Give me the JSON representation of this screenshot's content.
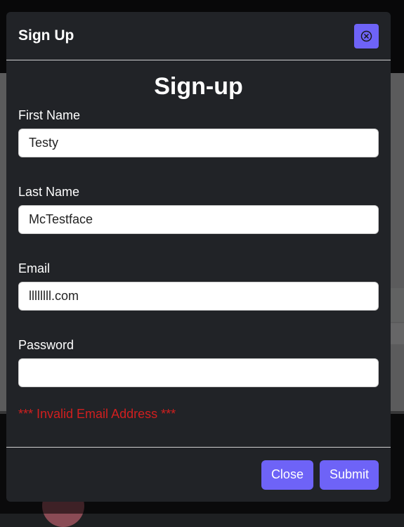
{
  "modal": {
    "title": "Sign Up",
    "close_icon": "close-circle-icon"
  },
  "form": {
    "heading": "Sign-up",
    "fields": [
      {
        "label": "First Name",
        "value": "Testy",
        "type": "text"
      },
      {
        "label": "Last Name",
        "value": "McTestface",
        "type": "text"
      },
      {
        "label": "Email",
        "value": "llllllll.com",
        "type": "text"
      },
      {
        "label": "Password",
        "value": "",
        "type": "password"
      }
    ],
    "error": "*** Invalid Email Address ***"
  },
  "footer": {
    "close_label": "Close",
    "submit_label": "Submit"
  },
  "colors": {
    "accent": "#6e63f7",
    "modal_bg": "#212327",
    "error": "#d11f1f"
  }
}
